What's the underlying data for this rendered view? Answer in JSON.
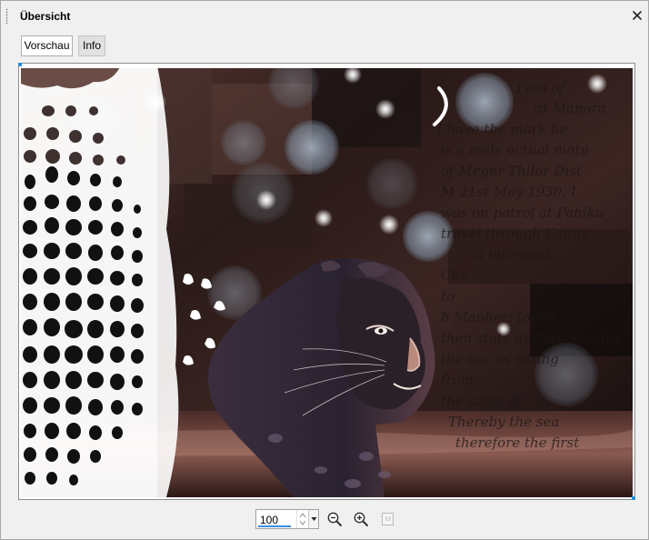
{
  "panel": {
    "title": "Übersicht",
    "close_icon": "close-icon"
  },
  "tabs": [
    {
      "label": "Vorschau",
      "active": true
    },
    {
      "label": "Info",
      "active": false
    }
  ],
  "preview": {
    "handwriting": [
      "I am of",
      "at Manora",
      "I have the mark he",
      "is a male actual matu",
      "of Meger Thilor Dist",
      "M 21st May 1930, I",
      "was on patrol at Pahiku",
      "travel through Kaliny",
      "a informed",
      "Cha",
      "to",
      "h Manheri forest of",
      "then state as they wonder",
      "the acc  as sitting",
      "from",
      "the same of",
      "Thereby the sea",
      "therefore the first"
    ],
    "accent_color": "#2a8fd6"
  },
  "zoom": {
    "value": "100",
    "zoom_out_icon": "zoom-out-icon",
    "zoom_in_icon": "zoom-in-icon",
    "actual_size_icon": "actual-size-icon",
    "accent_color": "#3c8be0"
  }
}
